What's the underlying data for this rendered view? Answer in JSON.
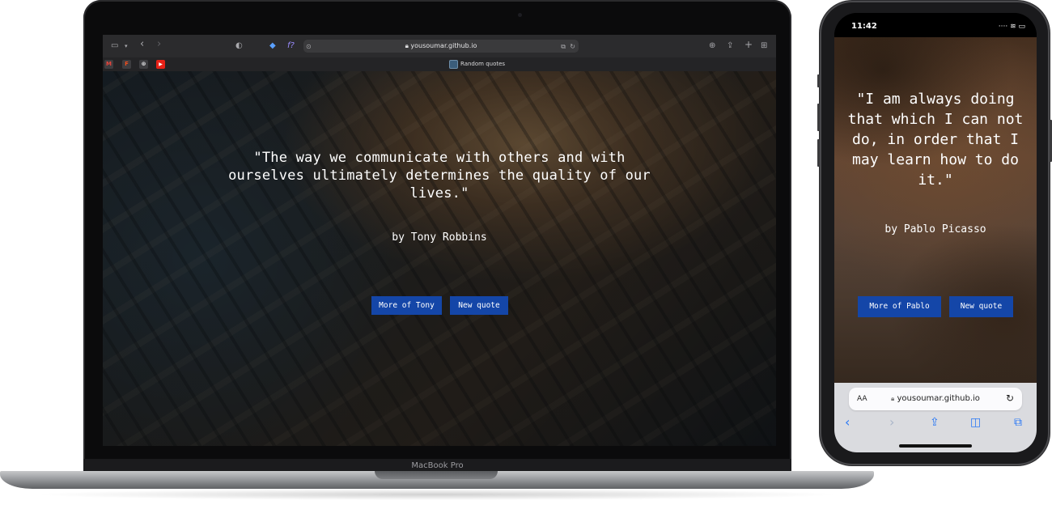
{
  "laptop": {
    "label": "MacBook Pro",
    "browser": {
      "address": "yousoumar.github.io",
      "tab_title": "Random quotes",
      "favorites": [
        {
          "name": "gmail",
          "glyph": "M",
          "color": "#3d3d40",
          "fg": "#e8453c"
        },
        {
          "name": "figma",
          "glyph": "F",
          "color": "#3d3d40",
          "fg": "#f24e1e"
        },
        {
          "name": "chatgpt",
          "glyph": "⊛",
          "color": "#3d3d40",
          "fg": "#e5e5e7"
        },
        {
          "name": "youtube",
          "glyph": "▶",
          "color": "#e62117",
          "fg": "#ffffff"
        }
      ]
    },
    "page": {
      "quote": "\"The way we communicate with others and with ourselves ultimately determines the quality of our lives.\"",
      "author": "by Tony Robbins",
      "more_button": "More of Tony",
      "new_button": "New quote"
    }
  },
  "phone": {
    "status": {
      "time": "11:42",
      "icons": "····  ≋  ▭"
    },
    "page": {
      "quote": "\"I am always doing that which I can not do, in order that I may learn how to do it.\"",
      "author": "by Pablo Picasso",
      "more_button": "More of Pablo",
      "new_button": "New quote"
    },
    "url_bar": {
      "aa": "AA",
      "address": "yousoumar.github.io"
    }
  },
  "colors": {
    "button": "#1446a8",
    "ios_accent": "#2a78f5"
  }
}
